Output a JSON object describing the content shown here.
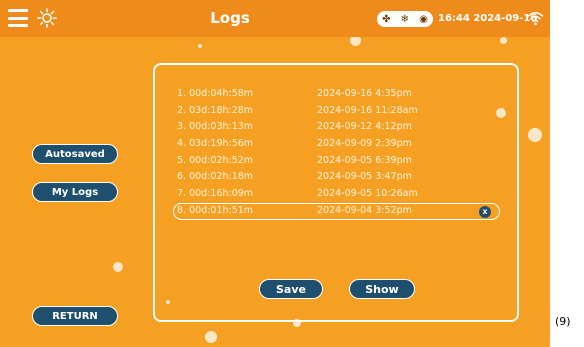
{
  "header": {
    "title": "Logs",
    "clock": "16:44 2024-09-16",
    "status_icons": [
      "fan-icon",
      "snowflake-icon",
      "disc-icon"
    ],
    "menu_icon": "hamburger-menu-icon",
    "theme_icon": "sun-icon",
    "signal_icon": "wifi-icon"
  },
  "sidebar": {
    "autosaved_label": "Autosaved",
    "my_logs_label": "My Logs",
    "return_label": "RETURN"
  },
  "logs": [
    {
      "duration": "1. 00d:04h:58m",
      "date": "2024-09-16 4:35pm",
      "selected": false
    },
    {
      "duration": "2. 03d:18h:28m",
      "date": "2024-09-16 11:28am",
      "selected": false
    },
    {
      "duration": "3. 00d:03h:13m",
      "date": "2024-09-12 4:12pm",
      "selected": false
    },
    {
      "duration": "4. 03d:19h:56m",
      "date": "2024-09-09 2:39pm",
      "selected": false
    },
    {
      "duration": "5. 00d:02h:52m",
      "date": "2024-09-05 6:39pm",
      "selected": false
    },
    {
      "duration": "6. 00d:02h:18m",
      "date": "2024-09-05 3:47pm",
      "selected": false
    },
    {
      "duration": "7. 00d:16h:09m",
      "date": "2024-09-05 10:26am",
      "selected": false
    },
    {
      "duration": "8. 00d:01h:51m",
      "date": "2024-09-04 3:52pm",
      "selected": true
    }
  ],
  "selected_close_label": "x",
  "actions": {
    "save_label": "Save",
    "show_label": "Show"
  },
  "edge_label": "(9)",
  "colors": {
    "background": "#f5a023",
    "header": "#ee8b1a",
    "button": "#1f4f6e"
  }
}
